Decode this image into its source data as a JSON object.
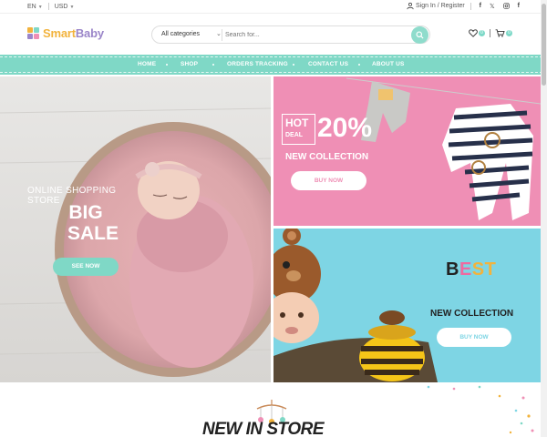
{
  "topbar": {
    "language": "EN",
    "currency": "USD",
    "signin_register": "Sign In / Register",
    "social": [
      "facebook-icon",
      "x-icon",
      "instagram-icon",
      "facebook-icon"
    ]
  },
  "header": {
    "logo_part1": "Smart",
    "logo_part2": "Baby",
    "category_label": "All categories",
    "search_placeholder": "Search for...",
    "wishlist_count": "0",
    "cart_count": "0"
  },
  "nav": {
    "items": [
      "HOME",
      "SHOP",
      "ORDERS TRACKING",
      "CONTACT US",
      "ABOUT US"
    ]
  },
  "hero": {
    "subtitle": "ONLINE SHOPPING STORE",
    "title_line1": "BIG",
    "title_line2": "SALE",
    "button": "SEE NOW"
  },
  "banner_pink": {
    "hot": "HOT",
    "deal": "DEAL",
    "percent": "20%",
    "collection": "NEW COLLECTION",
    "button": "BUY NOW"
  },
  "banner_blue": {
    "best_letters": [
      "B",
      "E",
      "S",
      "T"
    ],
    "collection": "NEW COLLECTION",
    "button": "BUY NOW"
  },
  "section": {
    "title": "NEW IN STORE"
  },
  "colors": {
    "accent": "#7fd8c6",
    "pink": "#ef8fb5",
    "blue": "#7ed5e4",
    "logo_yellow": "#f2b33d",
    "logo_purple": "#9b86c9"
  }
}
